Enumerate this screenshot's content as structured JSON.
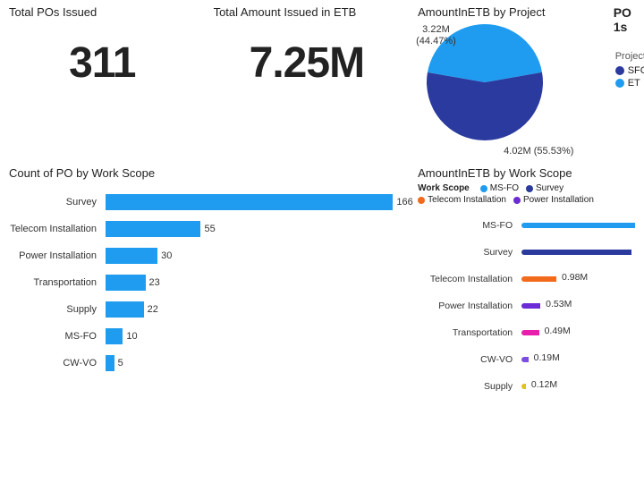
{
  "kpi_po": {
    "title": "Total POs Issued",
    "value": "311"
  },
  "kpi_amount": {
    "title": "Total Amount Issued in ETB",
    "value": "7.25M"
  },
  "pie": {
    "title": "AmountInETB by Project",
    "legend_title": "Project",
    "items": [
      {
        "name": "SFC",
        "value": 4020000,
        "label": "4.02M (55.53%)",
        "pct": 55.53,
        "color": "#2b3a9e"
      },
      {
        "name": "ET",
        "value": 3220000,
        "label": "3.22M\n(44.47%)",
        "pct": 44.47,
        "color": "#1f9cf0"
      }
    ]
  },
  "cut": {
    "line1": "PO",
    "line2": "1s"
  },
  "count_ws": {
    "title": "Count of PO by Work Scope",
    "max": 170,
    "items": [
      {
        "cat": "Survey",
        "val": 166
      },
      {
        "cat": "Telecom Installation",
        "val": 55
      },
      {
        "cat": "Power Installation",
        "val": 30
      },
      {
        "cat": "Transportation",
        "val": 23
      },
      {
        "cat": "Supply",
        "val": 22
      },
      {
        "cat": "MS-FO",
        "val": 10
      },
      {
        "cat": "CW-VO",
        "val": 5
      }
    ]
  },
  "amount_ws": {
    "title": "AmountInETB by Work Scope",
    "legend_label": "Work Scope",
    "max": 3.2,
    "items": [
      {
        "cat": "MS-FO",
        "val": 3.2,
        "label": "",
        "color": "#1f9cf0"
      },
      {
        "cat": "Survey",
        "val": 3.1,
        "label": "",
        "color": "#2b3a9e"
      },
      {
        "cat": "Telecom Installation",
        "val": 0.98,
        "label": "0.98M",
        "color": "#f26a1b"
      },
      {
        "cat": "Power Installation",
        "val": 0.53,
        "label": "0.53M",
        "color": "#6b2bd6"
      },
      {
        "cat": "Transportation",
        "val": 0.49,
        "label": "0.49M",
        "color": "#e81ead"
      },
      {
        "cat": "CW-VO",
        "val": 0.19,
        "label": "0.19M",
        "color": "#7b4de0"
      },
      {
        "cat": "Supply",
        "val": 0.12,
        "label": "0.12M",
        "color": "#e0c21e"
      }
    ]
  },
  "chart_data": [
    {
      "type": "pie",
      "title": "AmountInETB by Project",
      "series": [
        {
          "name": "SFC",
          "value": 4.02,
          "pct": 55.53
        },
        {
          "name": "ET",
          "value": 3.22,
          "pct": 44.47
        }
      ],
      "unit": "M ETB"
    },
    {
      "type": "bar",
      "title": "Count of PO by Work Scope",
      "orientation": "horizontal",
      "categories": [
        "Survey",
        "Telecom Installation",
        "Power Installation",
        "Transportation",
        "Supply",
        "MS-FO",
        "CW-VO"
      ],
      "values": [
        166,
        55,
        30,
        23,
        22,
        10,
        5
      ],
      "xlabel": "",
      "ylabel": "",
      "xlim": [
        0,
        170
      ]
    },
    {
      "type": "bar",
      "title": "AmountInETB by Work Scope",
      "orientation": "horizontal",
      "categories": [
        "MS-FO",
        "Survey",
        "Telecom Installation",
        "Power Installation",
        "Transportation",
        "CW-VO",
        "Supply"
      ],
      "values": [
        3.2,
        3.1,
        0.98,
        0.53,
        0.49,
        0.19,
        0.12
      ],
      "unit": "M ETB",
      "xlabel": "",
      "ylabel": "",
      "xlim": [
        0,
        3.2
      ]
    }
  ]
}
